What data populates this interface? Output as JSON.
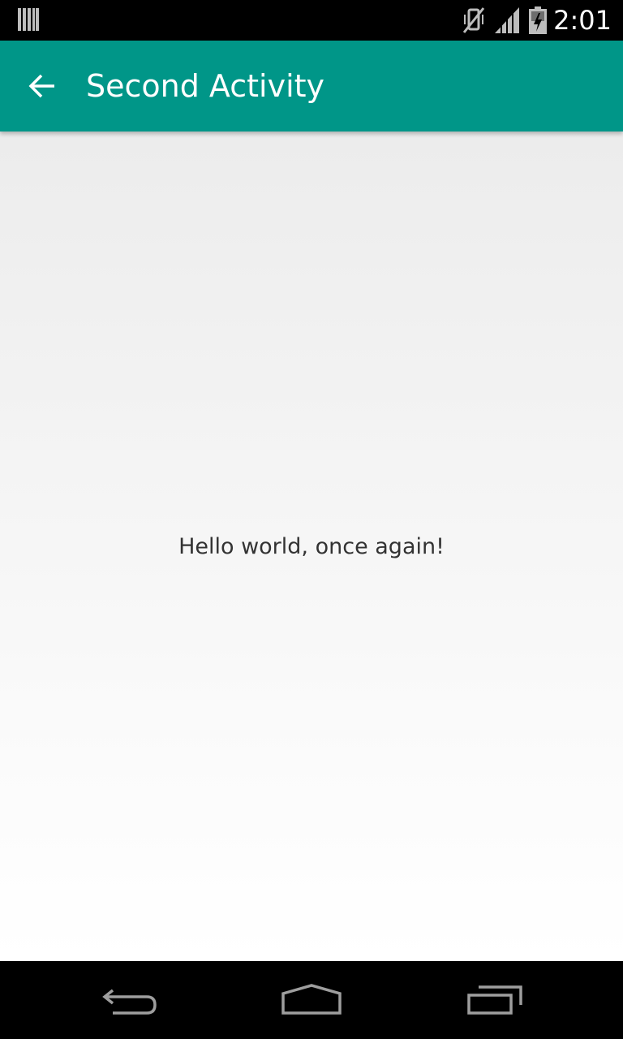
{
  "status_bar": {
    "time": "2:01",
    "icons": [
      "notification-barcode-icon",
      "vibrate-muted-icon",
      "signal-icon",
      "battery-icon"
    ]
  },
  "app_bar": {
    "title": "Second Activity",
    "back_icon": "arrow-back-icon",
    "color": "#009688"
  },
  "content": {
    "message": "Hello world, once again!"
  },
  "nav_bar": {
    "buttons": [
      "back-icon",
      "home-icon",
      "recents-icon"
    ]
  }
}
